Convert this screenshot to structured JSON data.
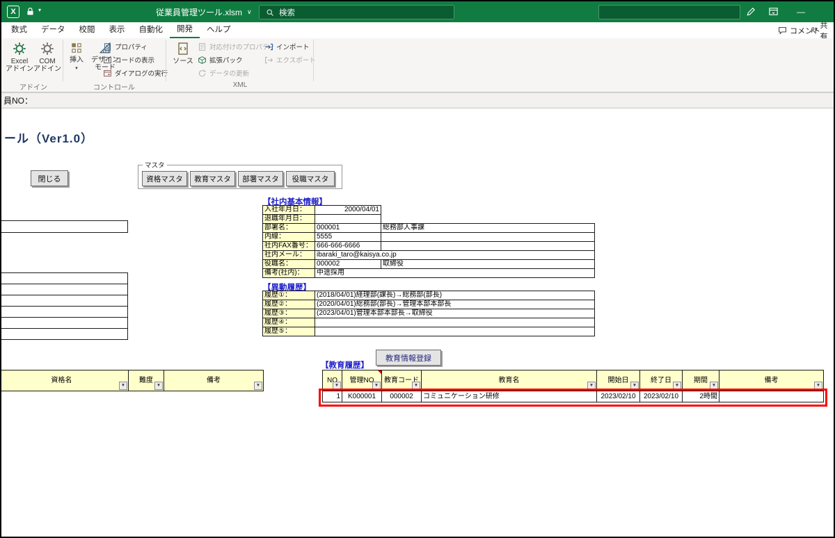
{
  "glyphs": {
    "excel_logo": "X",
    "title_caret": "∨",
    "dropdown_caret": "▾",
    "filter_arrow": "▼",
    "minimize": "—"
  },
  "titlebar": {
    "filename": "従業員管理ツール.xlsm",
    "search_placeholder": "検索"
  },
  "ribbon": {
    "tabs": [
      "数式",
      "データ",
      "校閲",
      "表示",
      "自動化",
      "開発",
      "ヘルプ"
    ],
    "comments": "コメント",
    "share": "共有",
    "addins": {
      "label": "アドイン",
      "excel": [
        "Excel",
        "アドイン"
      ],
      "com": [
        "COM",
        "アドイン"
      ]
    },
    "controls": {
      "label": "コントロール",
      "insert": "挿入",
      "design": [
        "デザイン",
        "モード"
      ],
      "properties": "プロパティ",
      "view_code": "コードの表示",
      "run_dialog": "ダイアログの実行"
    },
    "xml": {
      "label": "XML",
      "source": "ソース",
      "map_properties": "対応付けのプロパティ",
      "expansion_packs": "拡張パック",
      "refresh_data": "データの更新",
      "import": "インポート",
      "export": "エクスポート"
    }
  },
  "name_strip": {
    "text": "員NO："
  },
  "sheet": {
    "title": "ール（Ver1.0）",
    "close_button": "閉じる",
    "master": {
      "label": "マスタ",
      "buttons": [
        "資格マスタ",
        "教育マスタ",
        "部署マスタ",
        "役職マスタ"
      ]
    },
    "basic_info": {
      "heading": "【社内基本情報】",
      "rows": [
        {
          "label": "入社年月日：",
          "a": "2000/04/01",
          "b": ""
        },
        {
          "label": "退職年月日：",
          "a": "",
          "b": ""
        },
        {
          "label": "部署名：",
          "a": "000001",
          "b": "総務部人事課"
        },
        {
          "label": "内線：",
          "a": "5555",
          "b": ""
        },
        {
          "label": "社内FAX番号：",
          "a": "666-666-6666",
          "b": ""
        },
        {
          "label": "社内メール：",
          "a": "ibaraki_taro@kaisya.co.jp",
          "b": ""
        },
        {
          "label": "役職名：",
          "a": "000002",
          "b": "取締役"
        },
        {
          "label": "備考(社内)：",
          "a": "中途採用",
          "b": ""
        }
      ]
    },
    "idou": {
      "heading": "【異動履歴】",
      "rows": [
        {
          "label": "履歴①：",
          "value": "(2018/04/01)経理部(課長)→総務部(部長)"
        },
        {
          "label": "履歴②：",
          "value": "(2020/04/01)総務部(部長)→管理本部本部長"
        },
        {
          "label": "履歴③：",
          "value": "(2023/04/01)管理本部本部長→取締役"
        },
        {
          "label": "履歴④：",
          "value": ""
        },
        {
          "label": "履歴⑤：",
          "value": ""
        }
      ]
    },
    "register_button": "教育情報登録",
    "education": {
      "heading": "【教育履歴】",
      "headers": [
        "NO",
        "管理NO",
        "教育コード",
        "教育名",
        "開始日",
        "終了日",
        "期間",
        "備考"
      ],
      "row": {
        "no": "1",
        "kanri_no": "K000001",
        "code": "000002",
        "name": "コミュニケーション研修",
        "start": "2023/02/10",
        "end": "2023/02/10",
        "period": "2時間",
        "note": ""
      }
    },
    "qualification": {
      "headers": [
        "資格名",
        "難度",
        "備考"
      ]
    }
  }
}
